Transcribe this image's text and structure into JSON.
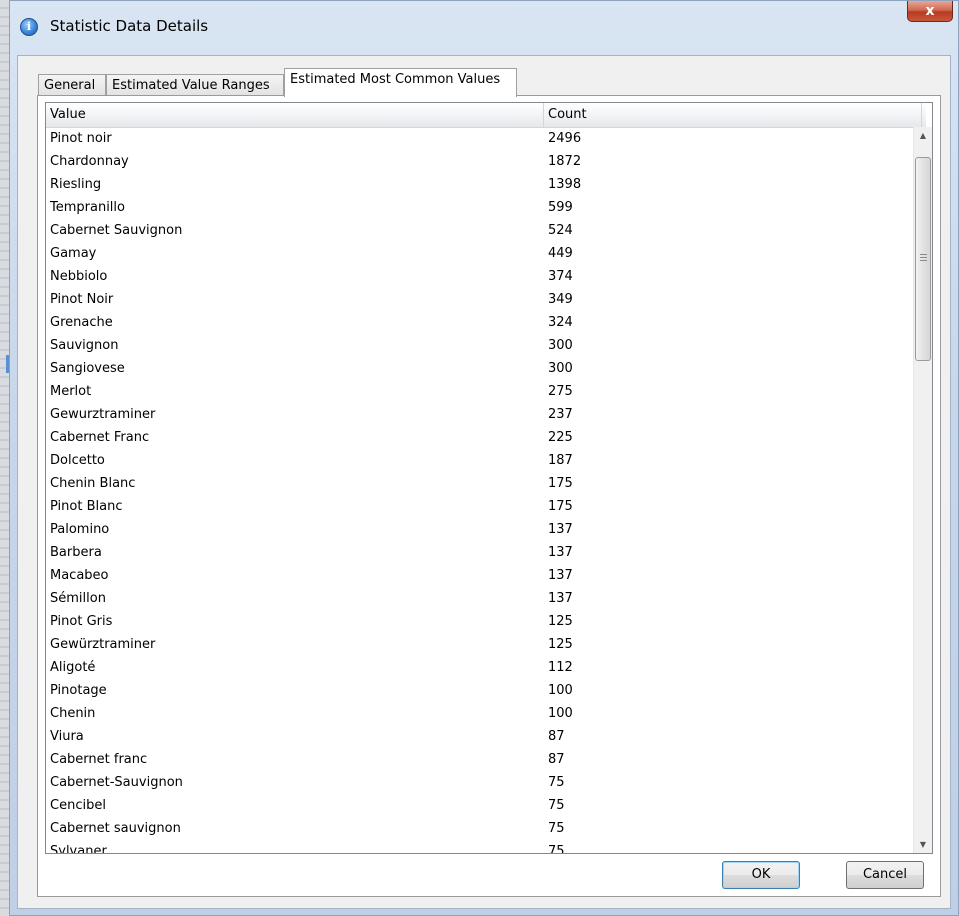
{
  "window": {
    "title": "Statistic Data Details",
    "close_label": "x",
    "title_icon": "info-icon"
  },
  "tabs": [
    {
      "label": "General",
      "active": false
    },
    {
      "label": "Estimated Value Ranges",
      "active": false
    },
    {
      "label": "Estimated Most Common Values",
      "active": true
    }
  ],
  "table": {
    "columns": [
      "Value",
      "Count"
    ],
    "rows": [
      [
        "Pinot noir",
        "2496"
      ],
      [
        "Chardonnay",
        "1872"
      ],
      [
        "Riesling",
        "1398"
      ],
      [
        "Tempranillo",
        "599"
      ],
      [
        "Cabernet Sauvignon",
        "524"
      ],
      [
        "Gamay",
        "449"
      ],
      [
        "Nebbiolo",
        "374"
      ],
      [
        "Pinot Noir",
        "349"
      ],
      [
        "Grenache",
        "324"
      ],
      [
        "Sauvignon",
        "300"
      ],
      [
        "Sangiovese",
        "300"
      ],
      [
        "Merlot",
        "275"
      ],
      [
        "Gewurztraminer",
        "237"
      ],
      [
        "Cabernet Franc",
        "225"
      ],
      [
        "Dolcetto",
        "187"
      ],
      [
        "Chenin Blanc",
        "175"
      ],
      [
        "Pinot Blanc",
        "175"
      ],
      [
        "Palomino",
        "137"
      ],
      [
        "Barbera",
        "137"
      ],
      [
        "Macabeo",
        "137"
      ],
      [
        "Sémillon",
        "137"
      ],
      [
        "Pinot Gris",
        "125"
      ],
      [
        "Gewürztraminer",
        "125"
      ],
      [
        "Aligoté",
        "112"
      ],
      [
        "Pinotage",
        "100"
      ],
      [
        "Chenin",
        "100"
      ],
      [
        "Viura",
        "87"
      ],
      [
        "Cabernet franc",
        "87"
      ],
      [
        "Cabernet-Sauvignon",
        "75"
      ],
      [
        "Cencibel",
        "75"
      ],
      [
        "Cabernet sauvignon",
        "75"
      ],
      [
        "Sylvaner",
        "75"
      ]
    ]
  },
  "buttons": {
    "ok_label": "OK",
    "cancel_label": "Cancel"
  }
}
